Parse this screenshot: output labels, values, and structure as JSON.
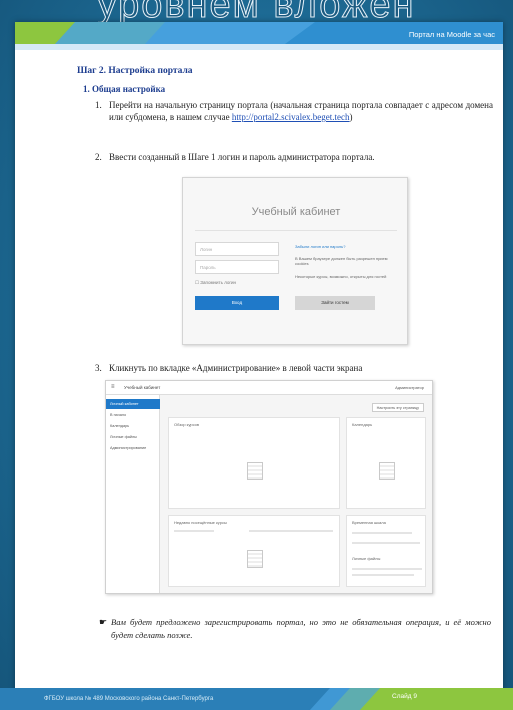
{
  "slide_title": "уровнем вложен",
  "header": {
    "text": "Портал на Moodle за час"
  },
  "step_heading": "Шаг 2. Настройка портала",
  "subsection": "1. Общая настройка",
  "items": [
    {
      "num": "1.",
      "text_before": "Перейти на начальную страницу портала (начальная страница портала совпадает с адресом домена или субдомена, в нашем случае ",
      "link": "http://portal2.scivalex.beget.tech",
      "text_after": ")"
    },
    {
      "num": "2.",
      "text": "Ввести созданный в Шаге 1 логин и пароль администратора портала."
    },
    {
      "num": "3.",
      "text": "Кликнуть по вкладке «Администрирование» в левой части экрана"
    }
  ],
  "login_screenshot": {
    "title": "Учебный кабинет",
    "username_placeholder": "Логин",
    "password_placeholder": "Пароль",
    "remember": "Запомнить логин",
    "login_button": "Вход",
    "forgot": "Забыли логин или пароль?",
    "cookies": "В Вашем браузере должен быть разрешен прием cookies",
    "guest_note": "Некоторые курсы, возможно, открыты для гостей",
    "guest_button": "Зайти гостем"
  },
  "admin_screenshot": {
    "brand": "Учебный кабинет",
    "user": "Администратор",
    "sidebar": [
      "Личный кабинет",
      "В начало",
      "Календарь",
      "Личные файлы",
      "Администрирование"
    ],
    "customize_button": "Настроить эту страницу",
    "panels": [
      "Обзор курсов",
      "Календарь",
      "Недавно посещённые курсы",
      "Временная шкала",
      "Личные файлы"
    ]
  },
  "note": "Вам будет предложено зарегистрировать портал, но это не обязательная операция, и её можно будет сделать позже.",
  "footer": {
    "left": "ФГБОУ школа № 489 Московского района Санкт-Петербурга",
    "right": "Слайд 9"
  },
  "colors": {
    "background": "#1e6a92",
    "accent_green": "#8dc63f",
    "accent_blue": "#1f79c9",
    "heading": "#1d3d8f"
  }
}
